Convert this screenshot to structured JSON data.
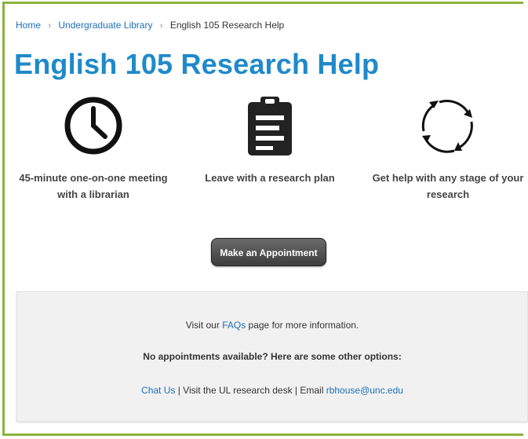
{
  "breadcrumb": {
    "items": [
      "Home",
      "Undergraduate Library",
      "English 105 Research Help"
    ],
    "separator": "›"
  },
  "page_title": "English 105 Research Help",
  "features": [
    {
      "icon": "clock-icon",
      "caption_line1": "45-minute one-on-one meeting",
      "caption_line2": "with a librarian"
    },
    {
      "icon": "clipboard-icon",
      "caption_line1": "Leave with a research plan",
      "caption_line2": ""
    },
    {
      "icon": "cycle-arrows-icon",
      "caption_line1": "Get help with any stage of your",
      "caption_line2": "research"
    }
  ],
  "appointment_button": "Make an Appointment",
  "info_panel": {
    "line1_prefix": "Visit our ",
    "line1_link": "FAQs",
    "line1_suffix": " page for more information.",
    "line2": "No appointments available? Here are some other options:",
    "chat_link": "Chat Us",
    "line3_middle": " | Visit the UL research desk | Email ",
    "email_link": "rbhouse@unc.edu"
  },
  "colors": {
    "frame_border": "#8cb33f",
    "title": "#1f8ac9",
    "link": "#1d6fb8",
    "button": "#4a4a4a",
    "panel_bg": "#f1f1f1"
  }
}
